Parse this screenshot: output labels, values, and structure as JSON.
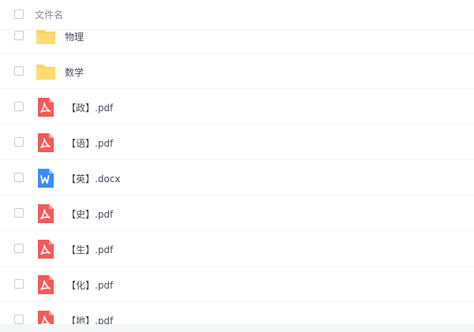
{
  "header": {
    "column_label": "文件名"
  },
  "files": [
    {
      "name": "物理",
      "type": "folder"
    },
    {
      "name": "数学",
      "type": "folder"
    },
    {
      "name": "【政】.pdf",
      "type": "pdf"
    },
    {
      "name": "【语】.pdf",
      "type": "pdf"
    },
    {
      "name": "【英】.docx",
      "type": "docx"
    },
    {
      "name": "【史】.pdf",
      "type": "pdf"
    },
    {
      "name": "【生】.pdf",
      "type": "pdf"
    },
    {
      "name": "【化】.pdf",
      "type": "pdf"
    },
    {
      "name": "【地】.pdf",
      "type": "pdf"
    }
  ],
  "icons": {
    "folder": "folder-icon",
    "pdf": "pdf-file-icon",
    "docx": "word-file-icon"
  },
  "colors": {
    "folder": "#ffd45c",
    "pdf": "#f25a5a",
    "docx": "#3f8cf6"
  }
}
